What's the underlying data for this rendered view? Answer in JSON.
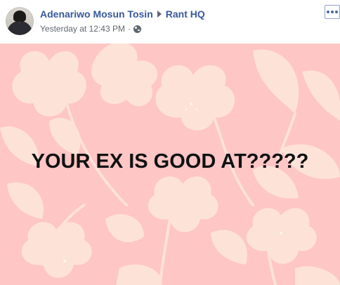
{
  "post": {
    "author": "Adenariwo Mosun Tosin",
    "group": "Rant HQ",
    "timestamp": "Yesterday at 12:43 PM",
    "separator": "·",
    "privacy_icon": "globe-icon",
    "more_icon": "more-options-icon"
  },
  "image": {
    "text": "YOUR EX IS GOOD AT?????",
    "background_color": "#fec6c5",
    "pattern_color": "#fde2d8",
    "pattern": "floral"
  }
}
